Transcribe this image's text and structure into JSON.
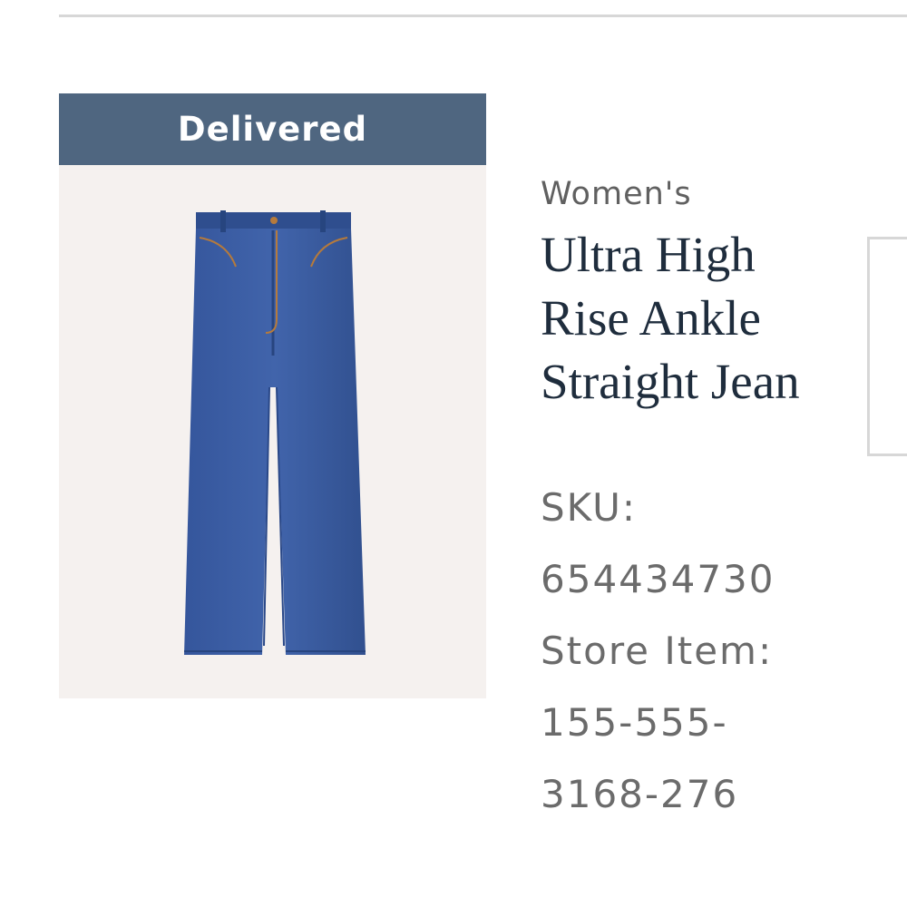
{
  "order_item": {
    "status": "Delivered",
    "image_icon": "jeans-product-image",
    "gender": "Women's",
    "name": "Ultra High Rise Ankle Straight Jean",
    "sku_label": "SKU:",
    "sku_value": "654434730",
    "store_item_label": "Store Item:",
    "store_item_line1": "155-555-",
    "store_item_line2": "3168-276"
  },
  "colors": {
    "banner": "#4f6680",
    "title": "#1f2d3d",
    "meta_text": "#6b6b6b",
    "divider": "#d7d7d7",
    "image_bg": "#f5f1ef",
    "denim": "#3a5aa0"
  }
}
